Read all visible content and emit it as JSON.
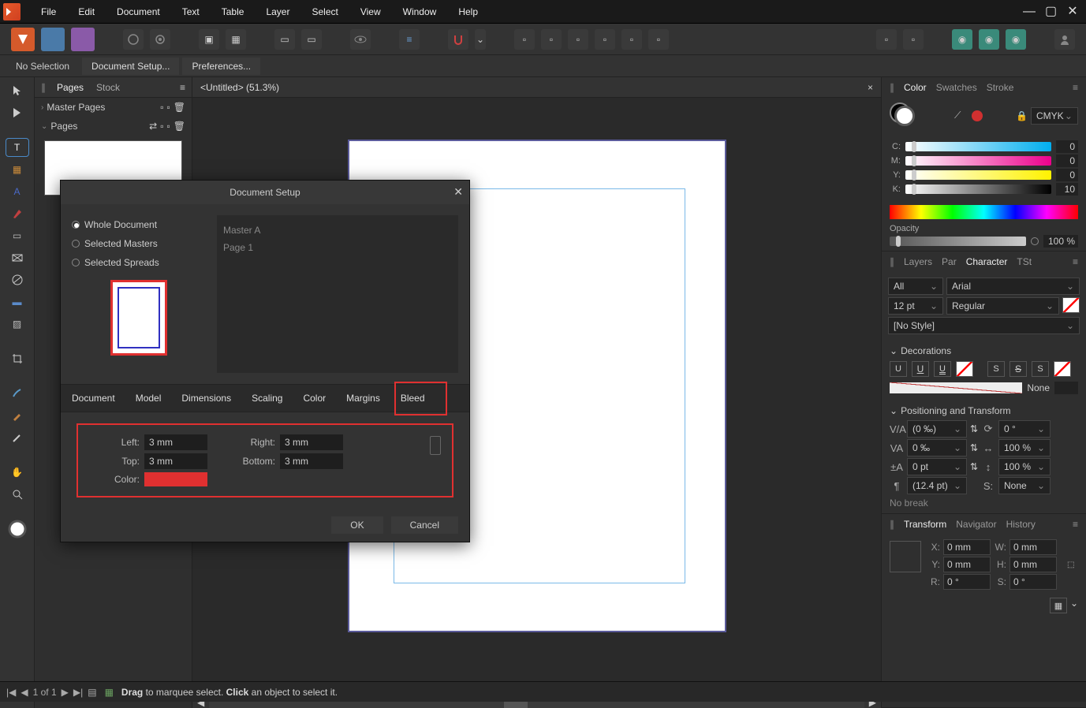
{
  "menu": {
    "file": "File",
    "edit": "Edit",
    "document": "Document",
    "text": "Text",
    "table": "Table",
    "layer": "Layer",
    "select": "Select",
    "view": "View",
    "window": "Window",
    "help": "Help"
  },
  "contextbar": {
    "no_selection": "No Selection",
    "doc_setup": "Document Setup...",
    "preferences": "Preferences..."
  },
  "pages": {
    "tab_pages": "Pages",
    "tab_stock": "Stock",
    "master_pages": "Master Pages",
    "pages": "Pages"
  },
  "doc_tab": {
    "title": "<Untitled> (51.3%)"
  },
  "color": {
    "tab_color": "Color",
    "tab_swatches": "Swatches",
    "tab_stroke": "Stroke",
    "mode": "CMYK",
    "c": "C:",
    "m": "M:",
    "y": "Y:",
    "k": "K:",
    "c_val": "0",
    "m_val": "0",
    "y_val": "0",
    "k_val": "10",
    "opacity_label": "Opacity",
    "opacity_val": "100 %"
  },
  "layers_tabs": {
    "layers": "Layers",
    "par": "Par",
    "character": "Character",
    "tst": "TSt"
  },
  "character": {
    "filter": "All",
    "font": "Arial",
    "size": "12 pt",
    "style": "Regular",
    "nostyle": "[No Style]",
    "decorations": "Decorations",
    "none_label": "None",
    "positioning": "Positioning and Transform",
    "tracking": "(0 ‰)",
    "baseline": "0 ‰",
    "leading": "0 pt",
    "paragraph": "(12.4 pt)",
    "rotation": "0 °",
    "hscale": "100 %",
    "vscale": "100 %",
    "shear": "None",
    "nobreak": "No break"
  },
  "transform_tabs": {
    "transform": "Transform",
    "navigator": "Navigator",
    "history": "History"
  },
  "transform": {
    "x": "X:",
    "y": "Y:",
    "w": "W:",
    "h": "H:",
    "r": "R:",
    "s": "S:",
    "x_val": "0 mm",
    "y_val": "0 mm",
    "w_val": "0 mm",
    "h_val": "0 mm",
    "r_val": "0 °",
    "s_val": "0 °"
  },
  "status": {
    "page": "1 of 1",
    "hint_drag": "Drag",
    "hint_marquee": " to marquee select. ",
    "hint_click": "Click",
    "hint_object": " an object to select it."
  },
  "dialog": {
    "title": "Document Setup",
    "radio_whole": "Whole Document",
    "radio_masters": "Selected Masters",
    "radio_spreads": "Selected Spreads",
    "master_a": "Master A",
    "page1": "Page 1",
    "tabs": {
      "document": "Document",
      "model": "Model",
      "dimensions": "Dimensions",
      "scaling": "Scaling",
      "color": "Color",
      "margins": "Margins",
      "bleed": "Bleed"
    },
    "left": "Left:",
    "right": "Right:",
    "top": "Top:",
    "bottom": "Bottom:",
    "color_label": "Color:",
    "left_val": "3 mm",
    "right_val": "3 mm",
    "top_val": "3 mm",
    "bottom_val": "3 mm",
    "ok": "OK",
    "cancel": "Cancel"
  }
}
